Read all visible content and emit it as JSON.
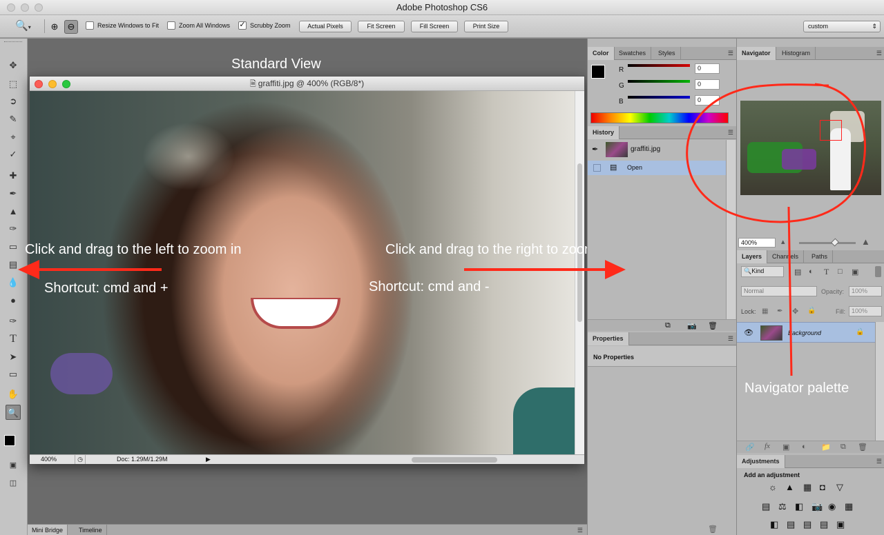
{
  "app": {
    "title": "Adobe Photoshop CS6"
  },
  "options_bar": {
    "resize_windows": "Resize Windows to Fit",
    "zoom_all": "Zoom All Windows",
    "scrubby_zoom": "Scrubby Zoom",
    "actual_pixels": "Actual Pixels",
    "fit_screen": "Fit Screen",
    "fill_screen": "Fill Screen",
    "print_size": "Print Size",
    "workspace": "custom"
  },
  "document": {
    "title": "graffiti.jpg @ 400% (RGB/8*)",
    "zoom": "400%",
    "doc_size": "Doc: 1.29M/1.29M"
  },
  "annotations": {
    "standard_view": "Standard View",
    "drag_left": "Click and drag to the left to zoom in",
    "drag_right": "Click and drag to the right to zoom out",
    "shortcut_in": "Shortcut: cmd and +",
    "shortcut_out": "Shortcut: cmd and -",
    "navigator_palette": "Navigator palette"
  },
  "color_panel": {
    "tabs": [
      "Color",
      "Swatches",
      "Styles"
    ],
    "channels": [
      {
        "label": "R",
        "value": "0",
        "color": "#d60000"
      },
      {
        "label": "G",
        "value": "0",
        "color": "#00b400"
      },
      {
        "label": "B",
        "value": "0",
        "color": "#0000d0"
      }
    ]
  },
  "history_panel": {
    "tab": "History",
    "snapshot": "graffiti.jpg",
    "state": "Open"
  },
  "properties_panel": {
    "tab": "Properties",
    "text": "No Properties"
  },
  "navigator_panel": {
    "tabs": [
      "Navigator",
      "Histogram"
    ],
    "zoom": "400%"
  },
  "layers_panel": {
    "tabs": [
      "Layers",
      "Channels",
      "Paths"
    ],
    "kind": "Kind",
    "blend_mode": "Normal",
    "opacity_label": "Opacity:",
    "opacity": "100%",
    "lock_label": "Lock:",
    "fill_label": "Fill:",
    "fill": "100%",
    "layer_name": "Background"
  },
  "adjustments_panel": {
    "tab": "Adjustments",
    "subtitle": "Add an adjustment"
  },
  "bottom_tabs": [
    "Mini Bridge",
    "Timeline"
  ],
  "colors": {
    "annotation_red": "#ff2a1a",
    "selection_blue": "#a8bfe0"
  }
}
